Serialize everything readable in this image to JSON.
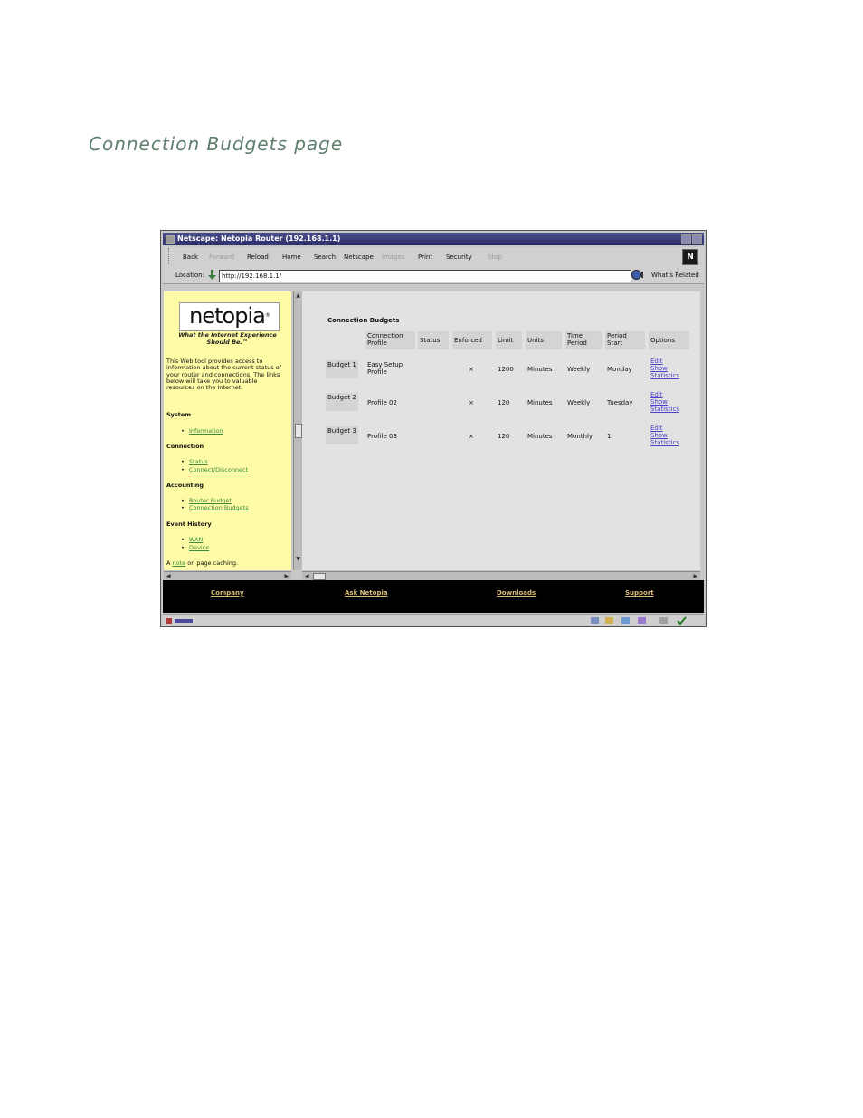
{
  "doc": {
    "heading": "Connection Budgets page"
  },
  "window": {
    "title": "Netscape: Netopia Router (192.168.1.1)"
  },
  "toolbar": {
    "back": "Back",
    "forward": "Forward",
    "reload": "Reload",
    "home": "Home",
    "search": "Search",
    "netscape": "Netscape",
    "images": "Images",
    "print": "Print",
    "security": "Security",
    "stop": "Stop",
    "logo": "N"
  },
  "location": {
    "label": "Location:",
    "url": "http://192.168.1.1/",
    "related": "What's Related"
  },
  "sidebar": {
    "logo_text": "netopia",
    "logo_mark": "®",
    "tagline": "What the Internet Experience Should Be.™",
    "intro": "This Web tool provides access to information about the current status of your router and connections. The links below will take you to valuable resources on the Internet.",
    "sections": {
      "system": {
        "title": "System",
        "links": [
          "Information"
        ]
      },
      "connection": {
        "title": "Connection",
        "links": [
          "Status",
          "Connect/Disconnect"
        ]
      },
      "accounting": {
        "title": "Accounting",
        "links": [
          "Router Budget",
          "Connection Budgets"
        ]
      },
      "event_history": {
        "title": "Event History",
        "links": [
          "WAN",
          "Device"
        ]
      }
    },
    "note_prefix": "A",
    "note_link": "note",
    "note_suffix": "on page caching."
  },
  "main": {
    "title": "Connection Budgets",
    "headers": {
      "profile": "Connection Profile",
      "status": "Status",
      "enforced": "Enforced",
      "limit": "Limit",
      "units": "Units",
      "period": "Time Period",
      "start": "Period Start",
      "options": "Options"
    },
    "rows": [
      {
        "name": "Budget 1",
        "profile": "Easy Setup Profile",
        "status": "",
        "enforced": "×",
        "limit": "1200",
        "units": "Minutes",
        "period": "Weekly",
        "start": "Monday",
        "opt_edit": "Edit",
        "opt_show": "Show",
        "opt_stats": "Statistics"
      },
      {
        "name": "Budget 2",
        "profile": "Profile 02",
        "status": "",
        "enforced": "×",
        "limit": "120",
        "units": "Minutes",
        "period": "Weekly",
        "start": "Tuesday",
        "opt_edit": "Edit",
        "opt_show": "Show",
        "opt_stats": "Statistics"
      },
      {
        "name": "Budget 3",
        "profile": "Profile 03",
        "status": "",
        "enforced": "×",
        "limit": "120",
        "units": "Minutes",
        "period": "Monthly",
        "start": "1",
        "opt_edit": "Edit",
        "opt_show": "Show",
        "opt_stats": "Statistics"
      }
    ]
  },
  "footer": {
    "links": [
      "Company",
      "Ask Netopia",
      "Downloads",
      "Support"
    ]
  },
  "colors": {
    "sidebar_bg": "#fdfba6",
    "link_green": "#3c8a3c",
    "option_link": "#4b40c8",
    "footer_bg": "#000000",
    "footer_link": "#d8c07a",
    "heading": "#5f7f6d"
  }
}
